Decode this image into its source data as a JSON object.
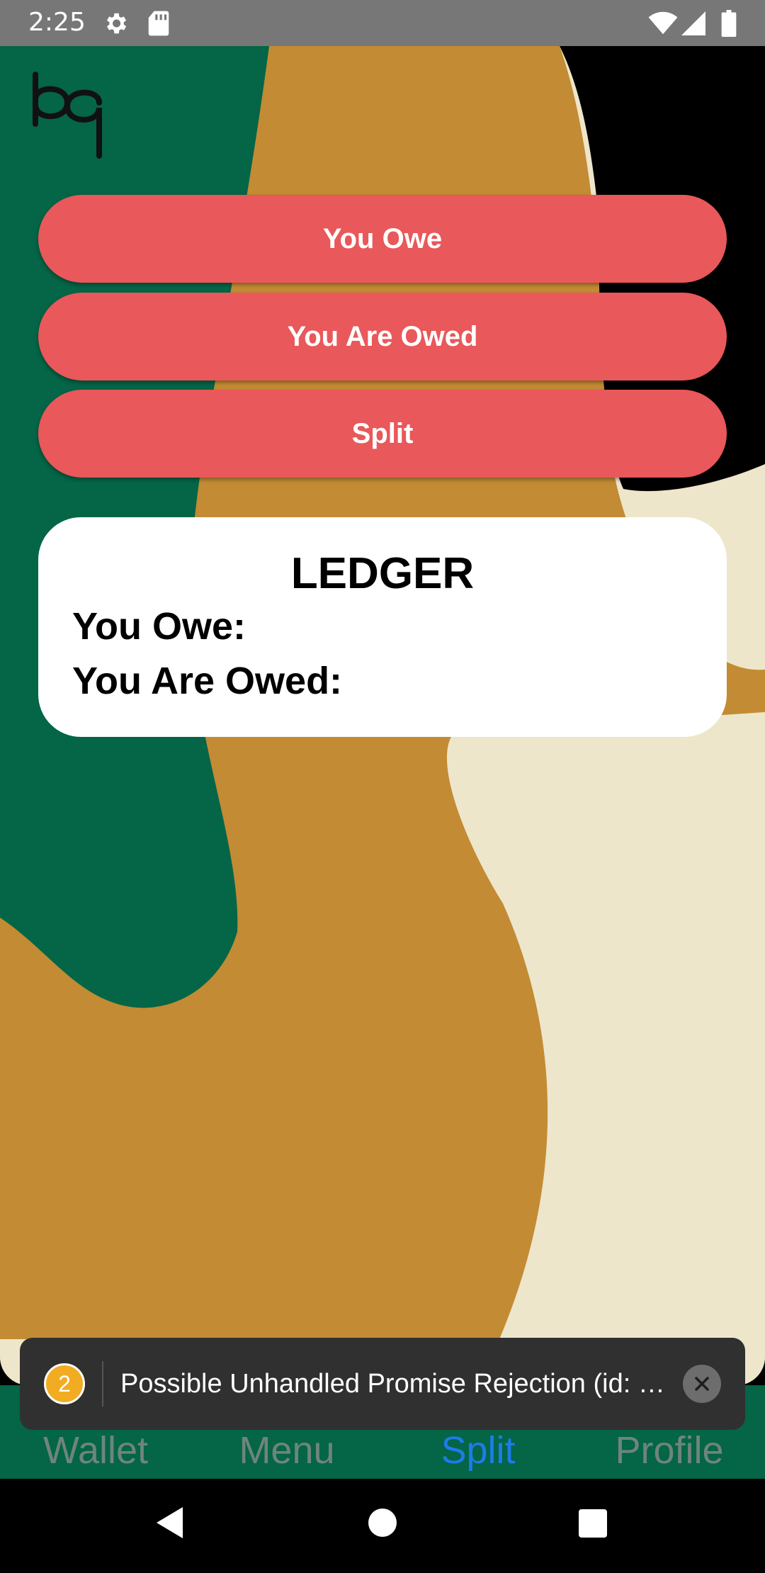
{
  "status_bar": {
    "time": "2:25",
    "icons": [
      "gear-icon",
      "sd-card-icon",
      "wifi-icon",
      "signal-icon",
      "battery-icon"
    ]
  },
  "colors": {
    "button": "#e9585a",
    "tab_bar": "#046547",
    "active_tab": "#1e7be8",
    "inactive_tab": "#6e857b",
    "bg_green": "#046547",
    "bg_ochre": "#c38b33",
    "bg_cream": "#ede6cb"
  },
  "app": {
    "logo": "bq-logo",
    "buttons": {
      "you_owe": "You Owe",
      "you_are_owed": "You Are Owed",
      "split": "Split"
    },
    "ledger": {
      "title": "LEDGER",
      "you_owe_label": "You Owe:",
      "you_are_owed_label": "You Are Owed:"
    }
  },
  "toast": {
    "count": "2",
    "message": "Possible Unhandled Promise Rejection (id: …",
    "close_icon": "close-icon"
  },
  "tabs": {
    "items": [
      {
        "label": "Wallet"
      },
      {
        "label": "Menu"
      },
      {
        "label": "Split",
        "active": true
      },
      {
        "label": "Profile"
      }
    ]
  },
  "nav": [
    "back-icon",
    "home-icon",
    "recents-icon"
  ]
}
